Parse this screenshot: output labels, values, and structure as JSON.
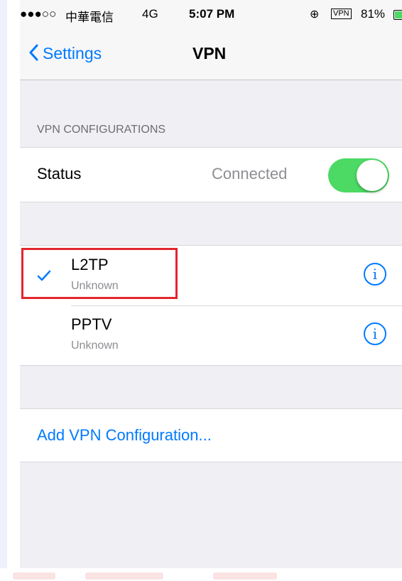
{
  "status_bar": {
    "signal_dots": "●●●○○",
    "carrier": "中華電信",
    "network": "4G",
    "time": "5:07 PM",
    "lock_icon": "⊕",
    "vpn_badge": "VPN",
    "battery_percent": "81%",
    "battery_level": 0.81
  },
  "nav": {
    "back_label": "Settings",
    "title": "VPN"
  },
  "section_header": "VPN CONFIGURATIONS",
  "status_row": {
    "label": "Status",
    "value": "Connected",
    "toggle_on": true
  },
  "vpn_list": [
    {
      "name": "L2TP",
      "status": "Unknown",
      "selected": true
    },
    {
      "name": "PPTV",
      "status": "Unknown",
      "selected": false
    }
  ],
  "info_glyph": "i",
  "add_config_label": "Add VPN Configuration...",
  "colors": {
    "accent": "#007aff",
    "toggle_on": "#4cd964",
    "highlight": "#e2262c"
  }
}
